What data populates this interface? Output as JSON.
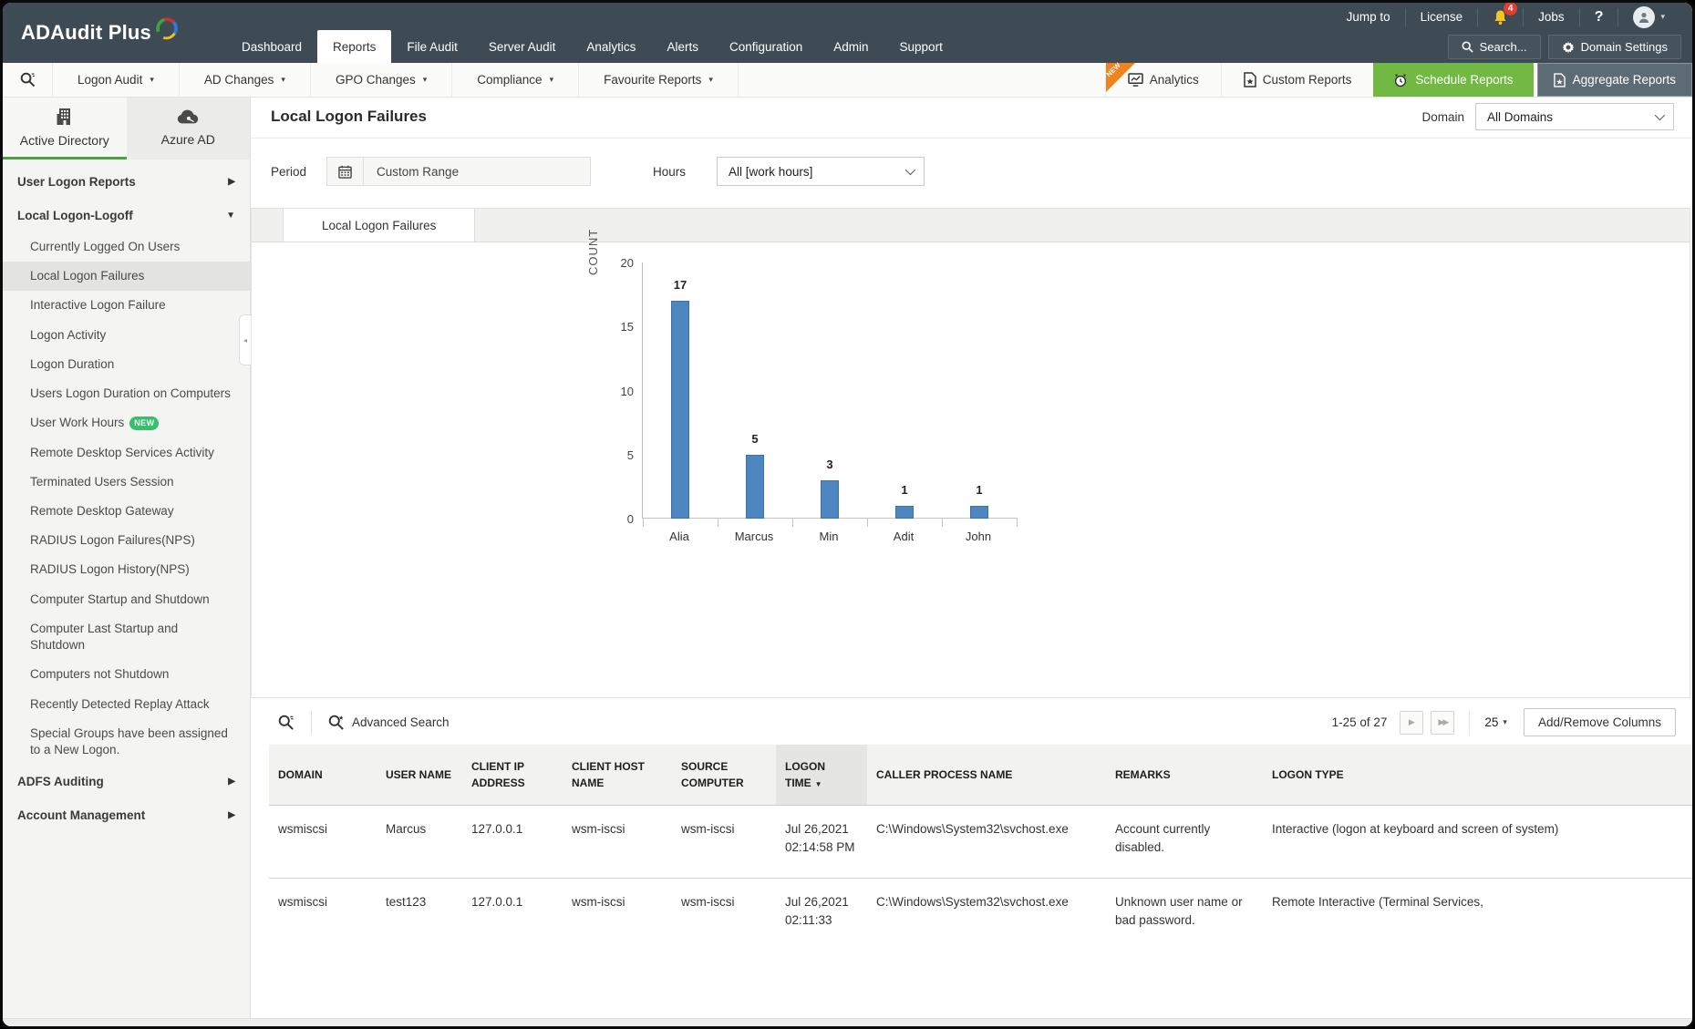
{
  "topbar": {
    "logo_text": "ADAudit Plus",
    "nav": [
      {
        "label": "Dashboard",
        "active": false
      },
      {
        "label": "Reports",
        "active": true
      },
      {
        "label": "File Audit",
        "active": false
      },
      {
        "label": "Server Audit",
        "active": false
      },
      {
        "label": "Analytics",
        "active": false
      },
      {
        "label": "Alerts",
        "active": false
      },
      {
        "label": "Configuration",
        "active": false
      },
      {
        "label": "Admin",
        "active": false
      },
      {
        "label": "Support",
        "active": false
      }
    ],
    "jump_to": "Jump to",
    "license": "License",
    "bell_count": "4",
    "jobs": "Jobs",
    "help": "?",
    "search_label": "Search...",
    "domain_settings_label": "Domain Settings"
  },
  "report_toolbar": {
    "menus": [
      "Logon Audit",
      "AD Changes",
      "GPO Changes",
      "Compliance",
      "Favourite Reports"
    ],
    "new_ribbon": "NEW",
    "analytics_label": "Analytics",
    "custom_reports_label": "Custom Reports",
    "schedule_reports_label": "Schedule Reports",
    "aggregate_reports_label": "Aggregate Reports"
  },
  "sidebar": {
    "tabs": [
      {
        "label": "Active Directory",
        "icon": "building-icon",
        "active": true
      },
      {
        "label": "Azure AD",
        "icon": "cloud-icon",
        "active": false
      }
    ],
    "groups_top": [
      {
        "label": "User Logon Reports",
        "state": "collapsed"
      },
      {
        "label": "Local Logon-Logoff",
        "state": "expanded"
      }
    ],
    "local_logon_children": [
      {
        "label": "Currently Logged On Users"
      },
      {
        "label": "Local Logon Failures",
        "active": true
      },
      {
        "label": "Interactive Logon Failure"
      },
      {
        "label": "Logon Activity"
      },
      {
        "label": "Logon Duration"
      },
      {
        "label": "Users Logon Duration on Computers"
      },
      {
        "label": "User Work Hours",
        "badge": "NEW"
      },
      {
        "label": "Remote Desktop Services Activity"
      },
      {
        "label": "Terminated Users Session"
      },
      {
        "label": "Remote Desktop Gateway"
      },
      {
        "label": "RADIUS Logon Failures(NPS)"
      },
      {
        "label": "RADIUS Logon History(NPS)"
      },
      {
        "label": "Computer Startup and Shutdown"
      },
      {
        "label": "Computer Last Startup and Shutdown"
      },
      {
        "label": "Computers not Shutdown"
      },
      {
        "label": "Recently Detected Replay Attack"
      },
      {
        "label": "Special Groups have been assigned to a New Logon."
      }
    ],
    "groups_bottom": [
      {
        "label": "ADFS Auditing",
        "state": "collapsed"
      },
      {
        "label": "Account Management",
        "state": "collapsed"
      }
    ]
  },
  "main": {
    "title": "Local Logon Failures",
    "domain_label": "Domain",
    "domain_value": "All Domains",
    "period_label": "Period",
    "period_value": "Custom Range",
    "hours_label": "Hours",
    "hours_value": "All [work hours]",
    "tab_label": "Local Logon Failures"
  },
  "chart_data": {
    "type": "bar",
    "categories": [
      "Alia",
      "Marcus",
      "Min",
      "Adit",
      "John"
    ],
    "values": [
      17,
      5,
      3,
      1,
      1
    ],
    "title": "",
    "xlabel": "",
    "ylabel": "COUNT",
    "ylim": [
      0,
      20
    ],
    "yticks": [
      0,
      5,
      10,
      15,
      20
    ],
    "bar_color": "#4d86c0",
    "grid": false,
    "legend": false
  },
  "table": {
    "advanced_search_label": "Advanced Search",
    "pagination": {
      "range": "1-25 of 27",
      "page_size": "25"
    },
    "add_remove_columns_label": "Add/Remove Columns",
    "columns": [
      {
        "label": "DOMAIN"
      },
      {
        "label": "USER NAME"
      },
      {
        "label": "CLIENT IP ADDRESS"
      },
      {
        "label": "CLIENT HOST NAME"
      },
      {
        "label": "SOURCE COMPUTER"
      },
      {
        "label": "LOGON TIME",
        "sorted": "desc"
      },
      {
        "label": "CALLER PROCESS NAME"
      },
      {
        "label": "REMARKS"
      },
      {
        "label": "LOGON TYPE"
      }
    ],
    "rows": [
      [
        "wsmiscsi",
        "Marcus",
        "127.0.0.1",
        "wsm-iscsi",
        "wsm-iscsi",
        "Jul 26,2021 02:14:58 PM",
        "C:\\Windows\\System32\\svchost.exe",
        "Account currently disabled.",
        "Interactive (logon at keyboard and screen of system)"
      ],
      [
        "wsmiscsi",
        "test123",
        "127.0.0.1",
        "wsm-iscsi",
        "wsm-iscsi",
        "Jul 26,2021 02:11:33",
        "C:\\Windows\\System32\\svchost.exe",
        "Unknown user name or bad password.",
        "Remote Interactive (Terminal Services,"
      ]
    ]
  },
  "colors": {
    "topbar_bg": "#3e4b55",
    "accent_green": "#72b944",
    "ribbon_orange": "#f0831f",
    "tab_underline_green": "#4ba046",
    "badge_green": "#35c06a",
    "bar_blue": "#4d86c0",
    "bell_yellow": "#f5c31d",
    "badge_red": "#e23c33"
  }
}
